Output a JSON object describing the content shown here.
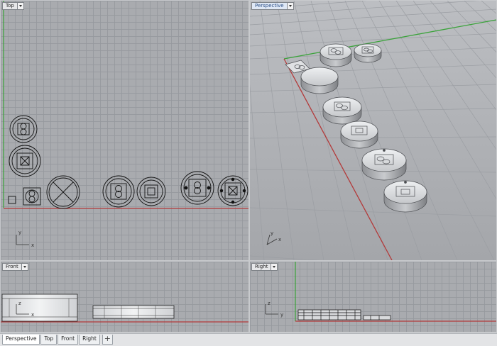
{
  "viewports": {
    "top": {
      "label": "Top",
      "axis_x": "x",
      "axis_y": "y"
    },
    "persp": {
      "label": "Perspective",
      "axis_x": "x",
      "axis_y": "y"
    },
    "front": {
      "label": "Front",
      "axis_x": "x",
      "axis_y": "z"
    },
    "right": {
      "label": "Right",
      "axis_x": "y",
      "axis_y": "z"
    }
  },
  "tabs": [
    {
      "label": "Perspective",
      "active": true
    },
    {
      "label": "Top"
    },
    {
      "label": "Front"
    },
    {
      "label": "Right"
    }
  ],
  "add_tab_label": "+",
  "colors": {
    "grid_background": "#a9abaf",
    "grid_line": "#96999e",
    "x_axis": "#b33a3a",
    "y_axis": "#3aa33a",
    "active_label": "#2c4f86"
  }
}
